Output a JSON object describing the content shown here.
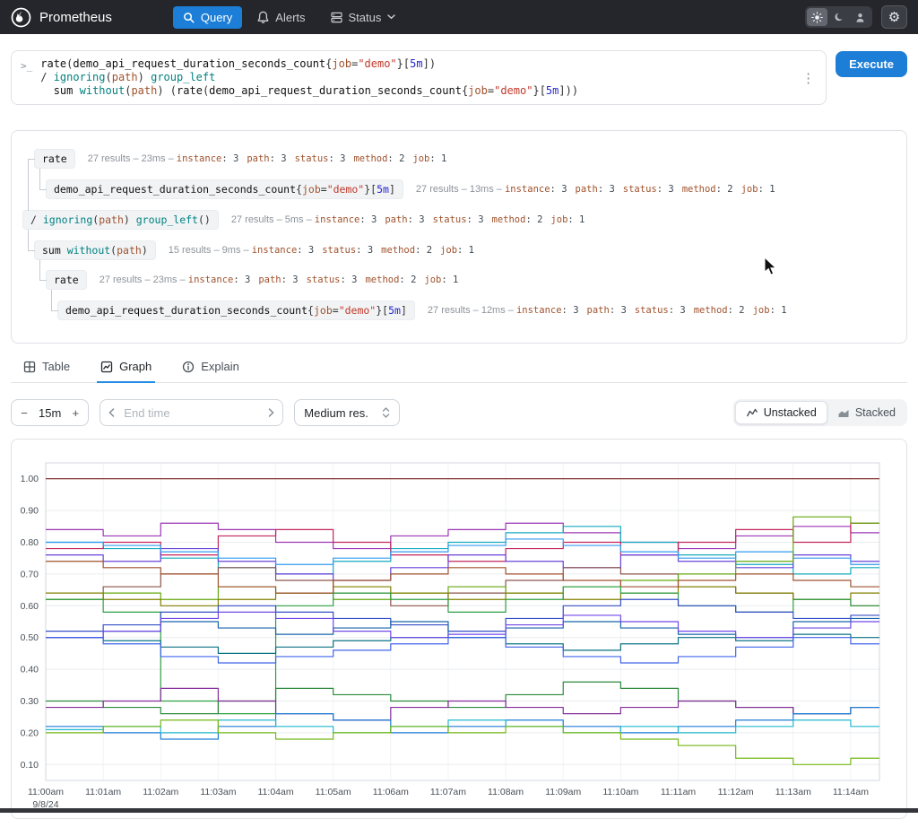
{
  "nav": {
    "brand": "Prometheus",
    "query": "Query",
    "alerts": "Alerts",
    "status": "Status",
    "gear_icon": "⚙"
  },
  "query": {
    "prompt": ">_",
    "menu_icon": "⋮",
    "execute_label": "Execute"
  },
  "editor": {
    "lines": [
      [
        {
          "t": "fn",
          "x": "rate"
        },
        {
          "t": "punct",
          "x": "("
        },
        {
          "t": "metric",
          "x": "demo_api_request_duration_seconds_count"
        },
        {
          "t": "punct",
          "x": "{"
        },
        {
          "t": "label",
          "x": "job"
        },
        {
          "t": "punct",
          "x": "="
        },
        {
          "t": "str",
          "x": "\"demo\""
        },
        {
          "t": "punct",
          "x": "}"
        },
        {
          "t": "punct",
          "x": "["
        },
        {
          "t": "dur",
          "x": "5m"
        },
        {
          "t": "punct",
          "x": "])"
        }
      ],
      [
        {
          "t": "punct",
          "x": "/ "
        },
        {
          "t": "kw",
          "x": "ignoring"
        },
        {
          "t": "punct",
          "x": "("
        },
        {
          "t": "label",
          "x": "path"
        },
        {
          "t": "punct",
          "x": ") "
        },
        {
          "t": "kw",
          "x": "group_left"
        }
      ],
      [
        {
          "t": "punct",
          "x": "  "
        },
        {
          "t": "fn",
          "x": "sum"
        },
        {
          "t": "punct",
          "x": " "
        },
        {
          "t": "kw",
          "x": "without"
        },
        {
          "t": "punct",
          "x": "("
        },
        {
          "t": "label",
          "x": "path"
        },
        {
          "t": "punct",
          "x": ") ("
        },
        {
          "t": "fn",
          "x": "rate"
        },
        {
          "t": "punct",
          "x": "("
        },
        {
          "t": "metric",
          "x": "demo_api_request_duration_seconds_count"
        },
        {
          "t": "punct",
          "x": "{"
        },
        {
          "t": "label",
          "x": "job"
        },
        {
          "t": "punct",
          "x": "="
        },
        {
          "t": "str",
          "x": "\"demo\""
        },
        {
          "t": "punct",
          "x": "}"
        },
        {
          "t": "punct",
          "x": "["
        },
        {
          "t": "dur",
          "x": "5m"
        },
        {
          "t": "punct",
          "x": "]))"
        }
      ]
    ]
  },
  "tree": {
    "meta_separator": " – ",
    "nodes": [
      {
        "indent": 2,
        "parent": 2,
        "chip": [
          {
            "t": "fn",
            "x": "rate"
          }
        ],
        "stats": "27 results – 23ms",
        "labels": [
          [
            "instance",
            3
          ],
          [
            "path",
            3
          ],
          [
            "status",
            3
          ],
          [
            "method",
            2
          ],
          [
            "job",
            1
          ]
        ]
      },
      {
        "indent": 3,
        "parent": 0,
        "chip": [
          {
            "t": "metric",
            "x": "demo_api_request_duration_seconds_count"
          },
          {
            "t": "punct",
            "x": "{"
          },
          {
            "t": "label",
            "x": "job"
          },
          {
            "t": "punct",
            "x": "="
          },
          {
            "t": "str",
            "x": "\"demo\""
          },
          {
            "t": "punct",
            "x": "}"
          },
          {
            "t": "punct",
            "x": "["
          },
          {
            "t": "dur",
            "x": "5m"
          },
          {
            "t": "punct",
            "x": "]"
          }
        ],
        "stats": "27 results – 13ms",
        "labels": [
          [
            "instance",
            3
          ],
          [
            "path",
            3
          ],
          [
            "status",
            3
          ],
          [
            "method",
            2
          ],
          [
            "job",
            1
          ]
        ]
      },
      {
        "indent": 1,
        "parent": null,
        "chip": [
          {
            "t": "punct",
            "x": "/ "
          },
          {
            "t": "kw",
            "x": "ignoring"
          },
          {
            "t": "punct",
            "x": "("
          },
          {
            "t": "label",
            "x": "path"
          },
          {
            "t": "punct",
            "x": ") "
          },
          {
            "t": "kw",
            "x": "group_left"
          },
          {
            "t": "punct",
            "x": "()"
          }
        ],
        "stats": "27 results – 5ms",
        "labels": [
          [
            "instance",
            3
          ],
          [
            "path",
            3
          ],
          [
            "status",
            3
          ],
          [
            "method",
            2
          ],
          [
            "job",
            1
          ]
        ]
      },
      {
        "indent": 2,
        "parent": 2,
        "chip": [
          {
            "t": "fn",
            "x": "sum "
          },
          {
            "t": "kw",
            "x": "without"
          },
          {
            "t": "punct",
            "x": "("
          },
          {
            "t": "label",
            "x": "path"
          },
          {
            "t": "punct",
            "x": ")"
          }
        ],
        "stats": "15 results – 9ms",
        "labels": [
          [
            "instance",
            3
          ],
          [
            "status",
            3
          ],
          [
            "method",
            2
          ],
          [
            "job",
            1
          ]
        ]
      },
      {
        "indent": 3,
        "parent": 3,
        "chip": [
          {
            "t": "fn",
            "x": "rate"
          }
        ],
        "stats": "27 results – 23ms",
        "labels": [
          [
            "instance",
            3
          ],
          [
            "path",
            3
          ],
          [
            "status",
            3
          ],
          [
            "method",
            2
          ],
          [
            "job",
            1
          ]
        ]
      },
      {
        "indent": 4,
        "parent": 4,
        "chip": [
          {
            "t": "metric",
            "x": "demo_api_request_duration_seconds_count"
          },
          {
            "t": "punct",
            "x": "{"
          },
          {
            "t": "label",
            "x": "job"
          },
          {
            "t": "punct",
            "x": "="
          },
          {
            "t": "str",
            "x": "\"demo\""
          },
          {
            "t": "punct",
            "x": "}"
          },
          {
            "t": "punct",
            "x": "["
          },
          {
            "t": "dur",
            "x": "5m"
          },
          {
            "t": "punct",
            "x": "]"
          }
        ],
        "stats": "27 results – 12ms",
        "labels": [
          [
            "instance",
            3
          ],
          [
            "path",
            3
          ],
          [
            "status",
            3
          ],
          [
            "method",
            2
          ],
          [
            "job",
            1
          ]
        ]
      }
    ]
  },
  "tabs": [
    {
      "label": "Table"
    },
    {
      "label": "Graph"
    },
    {
      "label": "Explain"
    }
  ],
  "controls": {
    "minus": "−",
    "duration": "15m",
    "plus": "+",
    "end_time_placeholder": "End time",
    "resolution": "Medium res.",
    "unstacked": "Unstacked",
    "stacked": "Stacked"
  },
  "accent_color": "#1c7ed6",
  "chart_data": {
    "type": "line",
    "x_labels": [
      "11:00am",
      "11:01am",
      "11:02am",
      "11:03am",
      "11:04am",
      "11:05am",
      "11:06am",
      "11:07am",
      "11:08am",
      "11:09am",
      "11:10am",
      "11:11am",
      "11:12am",
      "11:13am",
      "11:14am"
    ],
    "x_sublabel": "9/8/24",
    "y_ticks": [
      0.1,
      0.2,
      0.3,
      0.4,
      0.5,
      0.6,
      0.7,
      0.8,
      0.9,
      1.0
    ],
    "ylim": [
      0.05,
      1.05
    ],
    "grid": true,
    "legend": "none",
    "series": [
      {
        "color": "#7f1d1d",
        "values": [
          1,
          1,
          1,
          1,
          1,
          1,
          1,
          1,
          1,
          1,
          1,
          1,
          1,
          1,
          1
        ]
      },
      {
        "color": "#9c36b5",
        "values": [
          0.84,
          0.82,
          0.86,
          0.84,
          0.8,
          0.78,
          0.82,
          0.84,
          0.86,
          0.83,
          0.8,
          0.78,
          0.82,
          0.85,
          0.83
        ]
      },
      {
        "color": "#15aabf",
        "values": [
          0.8,
          0.78,
          0.75,
          0.72,
          0.7,
          0.74,
          0.78,
          0.8,
          0.83,
          0.85,
          0.8,
          0.76,
          0.73,
          0.7,
          0.72
        ]
      },
      {
        "color": "#c2255c",
        "values": [
          0.78,
          0.8,
          0.76,
          0.82,
          0.84,
          0.8,
          0.76,
          0.74,
          0.78,
          0.8,
          0.76,
          0.8,
          0.84,
          0.8,
          0.86
        ]
      },
      {
        "color": "#6741d9",
        "values": [
          0.76,
          0.74,
          0.78,
          0.74,
          0.7,
          0.68,
          0.72,
          0.76,
          0.74,
          0.72,
          0.76,
          0.74,
          0.72,
          0.76,
          0.74
        ]
      },
      {
        "color": "#339af0",
        "values": [
          0.8,
          0.79,
          0.77,
          0.75,
          0.73,
          0.75,
          0.77,
          0.79,
          0.81,
          0.79,
          0.77,
          0.75,
          0.77,
          0.75,
          0.73
        ]
      },
      {
        "color": "#8c564b",
        "values": [
          0.62,
          0.66,
          0.7,
          0.72,
          0.68,
          0.64,
          0.6,
          0.64,
          0.68,
          0.72,
          0.7,
          0.66,
          0.64,
          0.62,
          0.6
        ]
      },
      {
        "color": "#66a80f",
        "values": [
          0.62,
          0.64,
          0.62,
          0.66,
          0.64,
          0.62,
          0.64,
          0.66,
          0.64,
          0.66,
          0.68,
          0.7,
          0.74,
          0.88,
          0.86
        ]
      },
      {
        "color": "#808000",
        "values": [
          0.64,
          0.62,
          0.6,
          0.62,
          0.64,
          0.66,
          0.64,
          0.62,
          0.64,
          0.62,
          0.64,
          0.66,
          0.64,
          0.62,
          0.64
        ]
      },
      {
        "color": "#a0522d",
        "values": [
          0.74,
          0.72,
          0.7,
          0.66,
          0.64,
          0.68,
          0.7,
          0.72,
          0.7,
          0.68,
          0.66,
          0.68,
          0.7,
          0.68,
          0.66
        ]
      },
      {
        "color": "#2f9e44",
        "values": [
          0.62,
          0.58,
          0.3,
          0.26,
          0.6,
          0.64,
          0.62,
          0.58,
          0.62,
          0.66,
          0.64,
          0.6,
          0.58,
          0.62,
          0.6
        ]
      },
      {
        "color": "#364fc7",
        "values": [
          0.52,
          0.54,
          0.58,
          0.6,
          0.58,
          0.56,
          0.54,
          0.52,
          0.56,
          0.6,
          0.62,
          0.6,
          0.58,
          0.56,
          0.57
        ]
      },
      {
        "color": "#1864ab",
        "values": [
          0.5,
          0.52,
          0.55,
          0.53,
          0.51,
          0.53,
          0.55,
          0.5,
          0.53,
          0.55,
          0.53,
          0.51,
          0.5,
          0.55,
          0.56
        ]
      },
      {
        "color": "#0b7285",
        "values": [
          0.5,
          0.49,
          0.47,
          0.45,
          0.47,
          0.49,
          0.5,
          0.5,
          0.48,
          0.46,
          0.48,
          0.5,
          0.49,
          0.51,
          0.5
        ]
      },
      {
        "color": "#7048e8",
        "values": [
          0.5,
          0.52,
          0.56,
          0.58,
          0.56,
          0.52,
          0.5,
          0.51,
          0.54,
          0.57,
          0.55,
          0.52,
          0.5,
          0.53,
          0.55
        ]
      },
      {
        "color": "#4263eb",
        "values": [
          0.5,
          0.48,
          0.44,
          0.42,
          0.44,
          0.46,
          0.48,
          0.5,
          0.47,
          0.44,
          0.42,
          0.44,
          0.47,
          0.5,
          0.48
        ]
      },
      {
        "color": "#2b8a3e",
        "values": [
          0.3,
          0.28,
          0.26,
          0.3,
          0.34,
          0.32,
          0.3,
          0.28,
          0.32,
          0.36,
          0.34,
          0.3,
          0.28,
          0.26,
          0.28
        ]
      },
      {
        "color": "#862e9c",
        "values": [
          0.28,
          0.3,
          0.34,
          0.3,
          0.26,
          0.24,
          0.28,
          0.3,
          0.28,
          0.26,
          0.28,
          0.3,
          0.28,
          0.26,
          0.28
        ]
      },
      {
        "color": "#1c7ed6",
        "values": [
          0.22,
          0.2,
          0.18,
          0.22,
          0.26,
          0.24,
          0.2,
          0.22,
          0.24,
          0.22,
          0.2,
          0.22,
          0.24,
          0.26,
          0.28
        ]
      },
      {
        "color": "#22b8cf",
        "values": [
          0.21,
          0.22,
          0.2,
          0.24,
          0.22,
          0.2,
          0.22,
          0.24,
          0.22,
          0.2,
          0.22,
          0.2,
          0.22,
          0.24,
          0.22
        ]
      },
      {
        "color": "#74b816",
        "values": [
          0.2,
          0.22,
          0.24,
          0.2,
          0.18,
          0.2,
          0.22,
          0.2,
          0.22,
          0.2,
          0.18,
          0.16,
          0.12,
          0.1,
          0.12
        ]
      }
    ]
  }
}
